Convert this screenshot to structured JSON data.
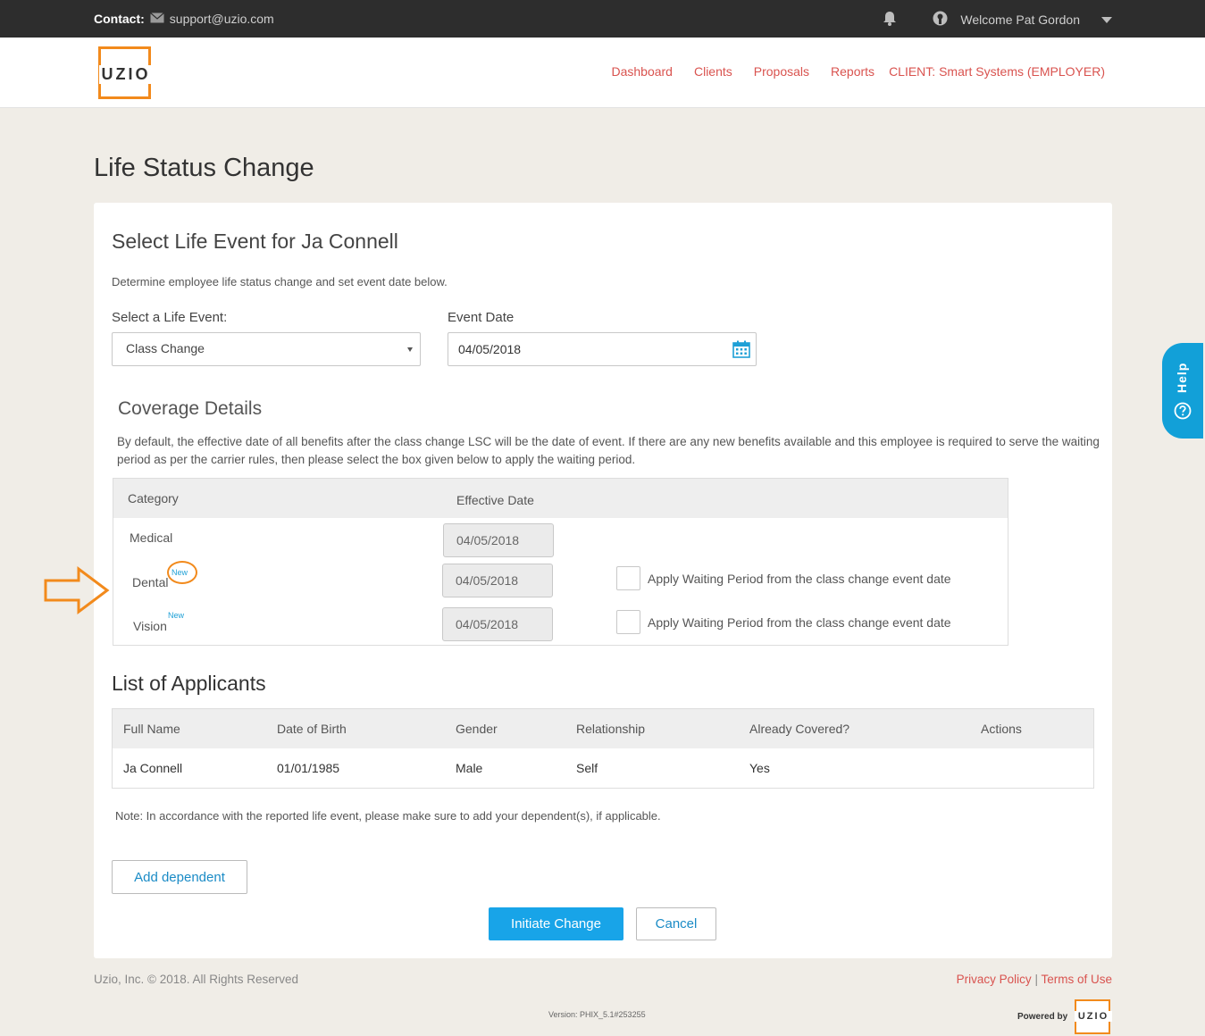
{
  "topbar": {
    "contact_label": "Contact:",
    "contact_email": "support@uzio.com",
    "welcome": "Welcome Pat Gordon"
  },
  "nav": {
    "logo": "UZIO",
    "links": [
      "Dashboard",
      "Clients",
      "Proposals",
      "Reports",
      "CLIENT: Smart Systems (EMPLOYER)"
    ]
  },
  "page": {
    "title": "Life Status Change"
  },
  "event": {
    "heading": "Select Life Event for Ja Connell",
    "intro": "Determine employee life status change and set event date below.",
    "life_event_label": "Select a Life Event:",
    "life_event_value": "Class Change",
    "event_date_label": "Event Date",
    "event_date_value": "04/05/2018"
  },
  "coverage": {
    "title": "Coverage Details",
    "description": "By default, the effective date of all benefits after the class change LSC will be the date of event. If there are any new benefits available and this employee is required to serve the waiting period as per the carrier rules, then please select the box given below to apply the waiting period.",
    "col_category": "Category",
    "col_effective": "Effective Date",
    "rows": [
      {
        "category": "Medical",
        "badge": "",
        "date": "04/05/2018",
        "waiting_label": ""
      },
      {
        "category": "Dental",
        "badge": "New",
        "date": "04/05/2018",
        "waiting_label": "Apply Waiting Period  from the class change event date"
      },
      {
        "category": "Vision",
        "badge": "New",
        "date": "04/05/2018",
        "waiting_label": "Apply Waiting Period  from the class change event date"
      }
    ]
  },
  "applicants": {
    "title": "List of Applicants",
    "columns": [
      "Full Name",
      "Date of Birth",
      "Gender",
      "Relationship",
      "Already Covered?",
      "Actions"
    ],
    "rows": [
      {
        "full_name": "Ja Connell",
        "dob": "01/01/1985",
        "gender": "Male",
        "relationship": "Self",
        "covered": "Yes"
      }
    ],
    "note": "Note: In accordance with the reported life event, please make sure to add your dependent(s), if applicable."
  },
  "buttons": {
    "add_dependent": "Add dependent",
    "initiate": "Initiate Change",
    "cancel": "Cancel"
  },
  "help": {
    "label": "Help"
  },
  "footer": {
    "copyright": "Uzio, Inc. © 2018. All Rights Reserved",
    "privacy": "Privacy Policy",
    "separator": "|",
    "terms": "Terms of Use",
    "version": "Version: PHIX_5.1#253255",
    "powered_by": "Powered by",
    "powered_logo": "UZIO"
  },
  "colors": {
    "accent_blue": "#18a4e8",
    "nav_red": "#d9534f",
    "brand_orange": "#f28a1c"
  }
}
